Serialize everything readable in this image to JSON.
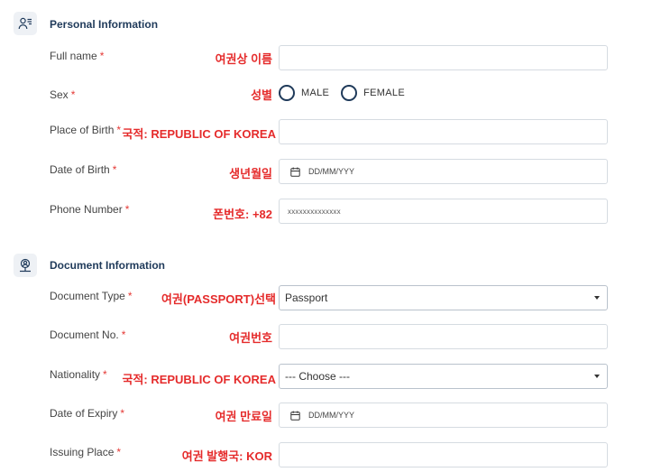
{
  "personal": {
    "title": "Personal Information",
    "icon": "person-list-icon",
    "full_name": {
      "label": "Full name",
      "required": "*",
      "note": "여권상 이름",
      "value": ""
    },
    "sex": {
      "label": "Sex",
      "required": "*",
      "note": "성별",
      "options": [
        "MALE",
        "FEMALE"
      ]
    },
    "place_of_birth": {
      "label": "Place of Birth",
      "required": "*",
      "note": "국적: REPUBLIC OF KOREA",
      "value": ""
    },
    "date_of_birth": {
      "label": "Date of Birth",
      "required": "*",
      "note": "생년월일",
      "placeholder": "DD/MM/YYY"
    },
    "phone": {
      "label": "Phone Number",
      "required": "*",
      "note": "폰번호: +82",
      "placeholder": "xxxxxxxxxxxxxx"
    }
  },
  "document": {
    "title": "Document Information",
    "icon": "location-person-icon",
    "doc_type": {
      "label": "Document Type",
      "required": "*",
      "note": "여권(PASSPORT)선택",
      "selected": "Passport"
    },
    "doc_no": {
      "label": "Document No.",
      "required": "*",
      "note": "여권번호",
      "value": ""
    },
    "nationality": {
      "label": "Nationality",
      "required": "*",
      "note": "국적: REPUBLIC OF KOREA",
      "selected": "--- Choose ---"
    },
    "expiry": {
      "label": "Date of Expiry",
      "required": "*",
      "note": "여권 만료일",
      "placeholder": "DD/MM/YYY"
    },
    "issuing_place": {
      "label": "Issuing Place",
      "required": "*",
      "note": "여권 발행국: KOR",
      "value": ""
    }
  },
  "colors": {
    "accent": "#1f3a5a",
    "required": "#e53935",
    "note": "#e52b2b",
    "border": "#d5dbe1"
  }
}
